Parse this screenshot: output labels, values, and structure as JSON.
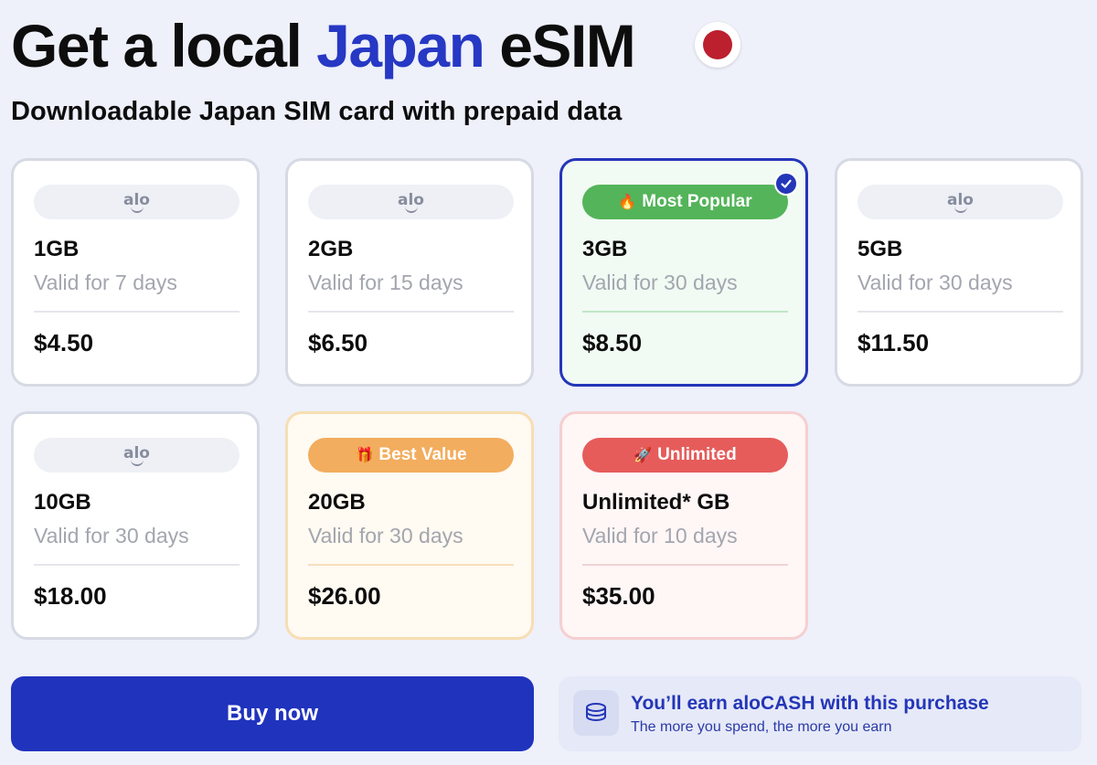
{
  "header": {
    "title_prefix": "Get a local ",
    "title_accent": "Japan",
    "title_suffix": " eSIM",
    "subtitle": "Downloadable Japan SIM card with prepaid data",
    "flag_icon": "japan-flag-icon"
  },
  "colors": {
    "accent": "#2638c4",
    "button": "#2033bd",
    "popular_badge": "#54b45a",
    "best_value_badge": "#f2ad5e",
    "unlimited_badge": "#e55c5a"
  },
  "plans": [
    {
      "badge": "alo",
      "data": "1GB",
      "validity": "Valid for 7 days",
      "price": "$4.50"
    },
    {
      "badge": "alo",
      "data": "2GB",
      "validity": "Valid for 15 days",
      "price": "$6.50"
    },
    {
      "badge": "Most Popular",
      "badge_emoji": "🔥",
      "data": "3GB",
      "validity": "Valid for 30 days",
      "price": "$8.50",
      "selected": true
    },
    {
      "badge": "alo",
      "data": "5GB",
      "validity": "Valid for 30 days",
      "price": "$11.50"
    },
    {
      "badge": "alo",
      "data": "10GB",
      "validity": "Valid for 30 days",
      "price": "$18.00"
    },
    {
      "badge": "Best Value",
      "badge_emoji": "🎁",
      "data": "20GB",
      "validity": "Valid for 30 days",
      "price": "$26.00"
    },
    {
      "badge": "Unlimited",
      "badge_emoji": "🚀",
      "data": "Unlimited* GB",
      "validity": "Valid for 10 days",
      "price": "$35.00"
    }
  ],
  "actions": {
    "buy_label": "Buy now"
  },
  "rewards": {
    "title": "You’ll earn aloCASH with this purchase",
    "subtitle": "The more you spend, the more you earn",
    "icon": "coins-icon"
  }
}
